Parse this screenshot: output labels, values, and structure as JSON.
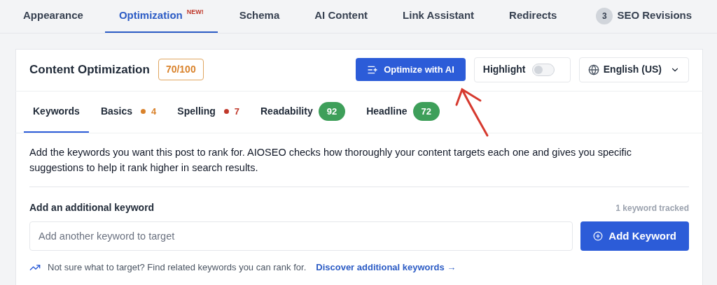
{
  "top_tabs": [
    {
      "label": "Appearance",
      "selected": false
    },
    {
      "label": "Optimization",
      "selected": true,
      "badge": "NEW!"
    },
    {
      "label": "Schema",
      "selected": false
    },
    {
      "label": "AI Content",
      "selected": false
    },
    {
      "label": "Link Assistant",
      "selected": false
    },
    {
      "label": "Redirects",
      "selected": false
    },
    {
      "label": "SEO Revisions",
      "selected": false,
      "count": "3"
    }
  ],
  "header": {
    "title": "Content Optimization",
    "score": "70/100",
    "optimize_button": "Optimize with AI",
    "highlight": {
      "label": "Highlight",
      "on": false
    },
    "language": "English (US)"
  },
  "sub_tabs": [
    {
      "label": "Keywords",
      "selected": true,
      "kind": "plain"
    },
    {
      "label": "Basics",
      "selected": false,
      "kind": "dot",
      "value": "4",
      "color": "#d9822b"
    },
    {
      "label": "Spelling",
      "selected": false,
      "kind": "dot",
      "value": "7",
      "color": "#c0392b"
    },
    {
      "label": "Readability",
      "selected": false,
      "kind": "pill",
      "value": "92",
      "color": "#3e9f5a"
    },
    {
      "label": "Headline",
      "selected": false,
      "kind": "pill",
      "value": "72",
      "color": "#3e9f5a"
    }
  ],
  "description": "Add the keywords you want this post to rank for. AIOSEO checks how thoroughly your content targets each one and gives you specific suggestions to help it rank higher in search results.",
  "keyword_section": {
    "label": "Add an additional keyword",
    "tracked": "1 keyword tracked",
    "input_placeholder": "Add another keyword to target",
    "add_button": "Add Keyword",
    "hint": "Not sure what to target? Find related keywords you can rank for.",
    "link": "Discover additional keywords →"
  }
}
